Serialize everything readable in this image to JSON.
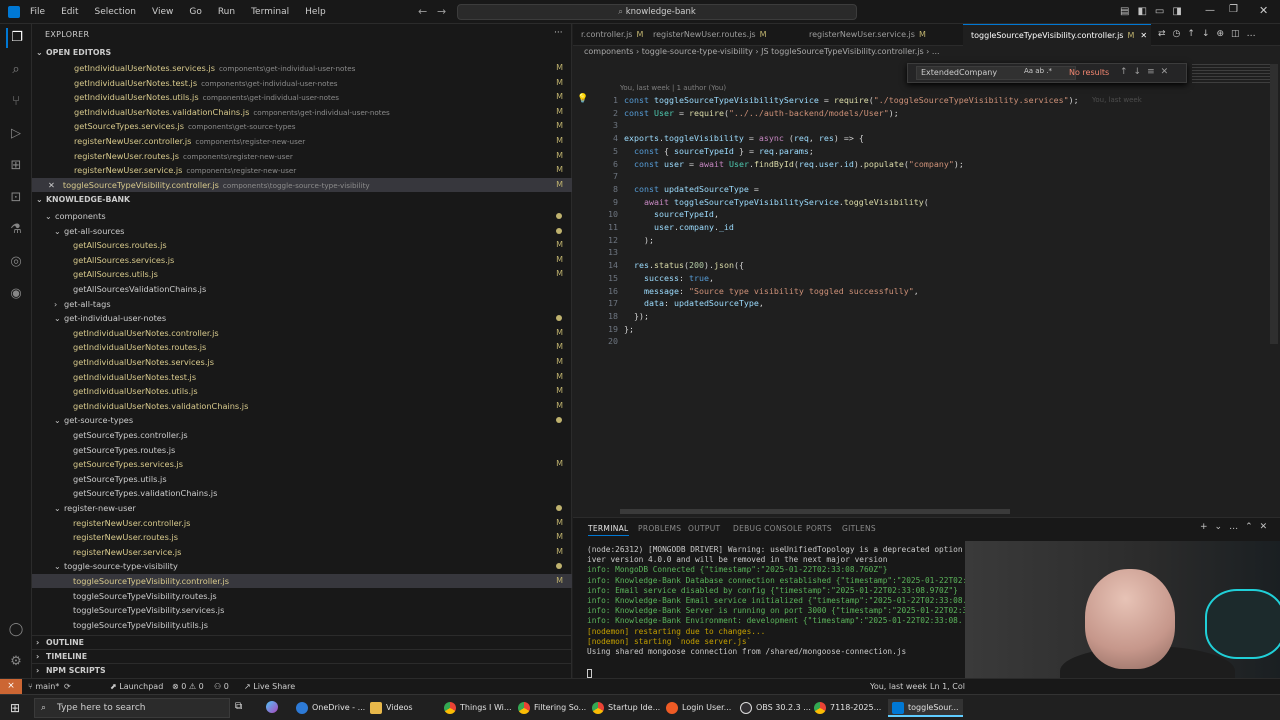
{
  "menu": [
    "File",
    "Edit",
    "Selection",
    "View",
    "Go",
    "Run",
    "Terminal",
    "Help"
  ],
  "search": "knowledge-bank",
  "explorer": {
    "title": "EXPLORER",
    "open_editors_label": "OPEN EDITORS",
    "open_editors": [
      {
        "name": "getIndividualUserNotes.services.js",
        "path": "components\\get-individual-user-notes",
        "badge": "M"
      },
      {
        "name": "getIndividualUserNotes.test.js",
        "path": "components\\get-individual-user-notes",
        "badge": "M"
      },
      {
        "name": "getIndividualUserNotes.utils.js",
        "path": "components\\get-individual-user-notes",
        "badge": "M"
      },
      {
        "name": "getIndividualUserNotes.validationChains.js",
        "path": "components\\get-individual-user-notes",
        "badge": "M"
      },
      {
        "name": "getSourceTypes.services.js",
        "path": "components\\get-source-types",
        "badge": "M"
      },
      {
        "name": "registerNewUser.controller.js",
        "path": "components\\register-new-user",
        "badge": "M"
      },
      {
        "name": "registerNewUser.routes.js",
        "path": "components\\register-new-user",
        "badge": "M"
      },
      {
        "name": "registerNewUser.service.js",
        "path": "components\\register-new-user",
        "badge": "M"
      },
      {
        "name": "toggleSourceTypeVisibility.controller.js",
        "path": "components\\toggle-source-type-visibility",
        "badge": "M"
      }
    ],
    "workspace": "KNOWLEDGE-BANK",
    "tree": [
      {
        "name": "components",
        "indent": 1,
        "folder": true,
        "dot": true
      },
      {
        "name": "get-all-sources",
        "indent": 2,
        "folder": true,
        "dot": true
      },
      {
        "name": "getAllSources.routes.js",
        "indent": 3,
        "badge": "M"
      },
      {
        "name": "getAllSources.services.js",
        "indent": 3,
        "badge": "M"
      },
      {
        "name": "getAllSources.utils.js",
        "indent": 3,
        "badge": "M"
      },
      {
        "name": "getAllSourcesValidationChains.js",
        "indent": 3,
        "badge": ""
      },
      {
        "name": "get-all-tags",
        "indent": 2,
        "folder": true,
        "closed": true
      },
      {
        "name": "get-individual-user-notes",
        "indent": 2,
        "folder": true,
        "dot": true
      },
      {
        "name": "getIndividualUserNotes.controller.js",
        "indent": 3,
        "badge": "M"
      },
      {
        "name": "getIndividualUserNotes.routes.js",
        "indent": 3,
        "badge": "M"
      },
      {
        "name": "getIndividualUserNotes.services.js",
        "indent": 3,
        "badge": "M"
      },
      {
        "name": "getIndividualUserNotes.test.js",
        "indent": 3,
        "badge": "M"
      },
      {
        "name": "getIndividualUserNotes.utils.js",
        "indent": 3,
        "badge": "M"
      },
      {
        "name": "getIndividualUserNotes.validationChains.js",
        "indent": 3,
        "badge": "M"
      },
      {
        "name": "get-source-types",
        "indent": 2,
        "folder": true,
        "dot": true
      },
      {
        "name": "getSourceTypes.controller.js",
        "indent": 3,
        "badge": ""
      },
      {
        "name": "getSourceTypes.routes.js",
        "indent": 3,
        "badge": ""
      },
      {
        "name": "getSourceTypes.services.js",
        "indent": 3,
        "badge": "M"
      },
      {
        "name": "getSourceTypes.utils.js",
        "indent": 3,
        "badge": ""
      },
      {
        "name": "getSourceTypes.validationChains.js",
        "indent": 3,
        "badge": ""
      },
      {
        "name": "register-new-user",
        "indent": 2,
        "folder": true,
        "dot": true
      },
      {
        "name": "registerNewUser.controller.js",
        "indent": 3,
        "badge": "M"
      },
      {
        "name": "registerNewUser.routes.js",
        "indent": 3,
        "badge": "M"
      },
      {
        "name": "registerNewUser.service.js",
        "indent": 3,
        "badge": "M"
      },
      {
        "name": "toggle-source-type-visibility",
        "indent": 2,
        "folder": true,
        "dot": true
      },
      {
        "name": "toggleSourceTypeVisibility.controller.js",
        "indent": 3,
        "badge": "M",
        "selected": true
      },
      {
        "name": "toggleSourceTypeVisibility.routes.js",
        "indent": 3,
        "badge": ""
      },
      {
        "name": "toggleSourceTypeVisibility.services.js",
        "indent": 3,
        "badge": ""
      },
      {
        "name": "toggleSourceTypeVisibility.utils.js",
        "indent": 3,
        "badge": ""
      }
    ],
    "outline": "OUTLINE",
    "timeline": "TIMELINE",
    "npm": "NPM SCRIPTS"
  },
  "tabs": [
    {
      "label": "r.controller.js",
      "badge": "M"
    },
    {
      "label": "registerNewUser.routes.js",
      "badge": "M"
    },
    {
      "label": "registerNewUser.service.js",
      "badge": "M"
    },
    {
      "label": "toggleSourceTypeVisibility.controller.js",
      "badge": "M",
      "active": true
    }
  ],
  "breadcrumbs": "components  ›  toggle-source-type-visibility  ›  JS  toggleSourceTypeVisibility.controller.js  ›  ...",
  "find": {
    "value": "ExtendedCompany",
    "result": "No results",
    "options": "Aa  ab  .*"
  },
  "blame": "You, last week | 1 author (You)",
  "inline_blame": "You, last week",
  "code_lines": [
    "const toggleSourceTypeVisibilityService = require(\"./toggleSourceTypeVisibility.services\");",
    "const User = require(\"../../auth-backend/models/User\");",
    "",
    "exports.toggleVisibility = async (req, res) => {",
    "  const { sourceTypeId } = req.params;",
    "  const user = await User.findById(req.user.id).populate(\"company\");",
    "",
    "  const updatedSourceType =",
    "    await toggleSourceTypeVisibilityService.toggleVisibility(",
    "      sourceTypeId,",
    "      user.company._id",
    "    );",
    "",
    "  res.status(200).json({",
    "    success: true,",
    "    message: \"Source type visibility toggled successfully\",",
    "    data: updatedSourceType,",
    "  });",
    "};",
    ""
  ],
  "panel": {
    "tabs": [
      "TERMINAL",
      "PROBLEMS",
      "OUTPUT",
      "DEBUG CONSOLE",
      "PORTS",
      "GITLENS"
    ],
    "terminal": [
      "(node:26312) [MONGODB DRIVER] Warning: useUnifiedTopology is a deprecated option",
      "iver version 4.0.0 and will be removed in the next major version",
      "info: MongoDB Connected {\"timestamp\":\"2025-01-22T02:33:08.760Z\"}",
      "info: Knowledge-Bank Database connection established {\"timestamp\":\"2025-01-22T02:",
      "info: Email service disabled by config {\"timestamp\":\"2025-01-22T02:33:08.970Z\"}",
      "info: Knowledge-Bank Email service initialized {\"timestamp\":\"2025-01-22T02:33:08.",
      "info: Knowledge-Bank Server is running on port 3000 {\"timestamp\":\"2025-01-22T02:33:0",
      "info: Knowledge-Bank Environment: development {\"timestamp\":\"2025-01-22T02:33:08.",
      "[nodemon] restarting due to changes...",
      "[nodemon] starting `node server.js`",
      "Using shared mongoose connection from /shared/mongoose-connection.js"
    ]
  },
  "status": {
    "branch": "main*",
    "launchpad": "Launchpad",
    "problems": "⊗ 0  ⚠ 0",
    "ports": "⚇ 0",
    "liveshare": "Live Share",
    "blame": "You, last week",
    "position": "Ln 1, Col"
  },
  "taskbar": {
    "search": "Type here to search",
    "items": [
      "OneDrive - ...",
      "Videos",
      "Things I Wi...",
      "Filtering So...",
      "Startup Ide...",
      "Login User...",
      "OBS 30.2.3 ...",
      "7118-2025...",
      "toggleSour..."
    ]
  },
  "colors": {
    "accent": "#0078d4",
    "modified": "#bfb26e",
    "status_remote": "#cc6633"
  }
}
